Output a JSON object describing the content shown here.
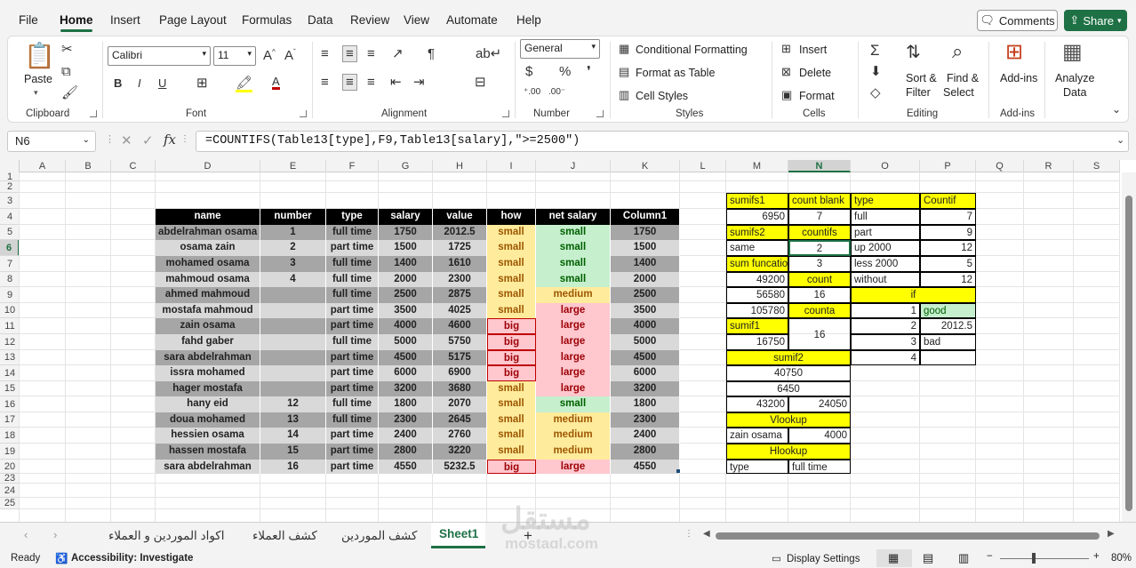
{
  "menu": [
    "File",
    "Home",
    "Insert",
    "Page Layout",
    "Formulas",
    "Data",
    "Review",
    "View",
    "Automate",
    "Help"
  ],
  "comments_label": "Comments",
  "share_label": "Share",
  "ribbon": {
    "clipboard": {
      "paste": "Paste",
      "label": "Clipboard"
    },
    "font": {
      "name": "Calibri",
      "size": "11",
      "label": "Font"
    },
    "alignment": {
      "label": "Alignment"
    },
    "number": {
      "format": "General",
      "label": "Number"
    },
    "styles": {
      "cond": "Conditional Formatting",
      "table": "Format as Table",
      "cell": "Cell Styles",
      "label": "Styles"
    },
    "cells": {
      "insert": "Insert",
      "delete": "Delete",
      "format": "Format",
      "label": "Cells"
    },
    "editing": {
      "sort": "Sort &",
      "filter": "Filter",
      "find": "Find &",
      "select": "Select",
      "label": "Editing"
    },
    "addins": {
      "btn": "Add-ins",
      "label": "Add-ins"
    },
    "analyze": {
      "l1": "Analyze",
      "l2": "Data"
    }
  },
  "namebox": "N6",
  "formula": "=COUNTIFS(Table13[type],F9,Table13[salary],\">=2500\")",
  "columns": [
    "A",
    "B",
    "C",
    "D",
    "E",
    "F",
    "G",
    "H",
    "I",
    "J",
    "K",
    "L",
    "M",
    "N",
    "O",
    "P",
    "Q",
    "R",
    "S"
  ],
  "rows": [
    "1",
    "2",
    "3",
    "4",
    "5",
    "6",
    "7",
    "8",
    "9",
    "10",
    "11",
    "12",
    "13",
    "14",
    "15",
    "16",
    "17",
    "18",
    "19",
    "20",
    "23",
    "24",
    "25"
  ],
  "table": {
    "headers": [
      "name",
      "number",
      "type",
      "salary",
      "value",
      "how",
      "net salary",
      "Column1"
    ],
    "rows": [
      [
        "abdelrahman osama",
        "1",
        "full time",
        "1750",
        "2012.5",
        "small",
        "small",
        "1750"
      ],
      [
        "osama zain",
        "2",
        "part time",
        "1500",
        "1725",
        "small",
        "small",
        "1500"
      ],
      [
        "mohamed osama",
        "3",
        "full time",
        "1400",
        "1610",
        "small",
        "small",
        "1400"
      ],
      [
        "mahmoud osama",
        "4",
        "full time",
        "2000",
        "2300",
        "small",
        "small",
        "2000"
      ],
      [
        "ahmed mahmoud",
        "",
        "full time",
        "2500",
        "2875",
        "small",
        "medium",
        "2500"
      ],
      [
        "mostafa mahmoud",
        "",
        "part time",
        "3500",
        "4025",
        "small",
        "large",
        "3500"
      ],
      [
        "zain osama",
        "",
        "part time",
        "4000",
        "4600",
        "big",
        "large",
        "4000"
      ],
      [
        "fahd gaber",
        "",
        "full time",
        "5000",
        "5750",
        "big",
        "large",
        "5000"
      ],
      [
        "sara abdelrahman",
        "",
        "part time",
        "4500",
        "5175",
        "big",
        "large",
        "4500"
      ],
      [
        "issra mohamed",
        "",
        "part time",
        "6000",
        "6900",
        "big",
        "large",
        "6000"
      ],
      [
        "hager mostafa",
        "",
        "part time",
        "3200",
        "3680",
        "small",
        "large",
        "3200"
      ],
      [
        "hany eid",
        "12",
        "full time",
        "1800",
        "2070",
        "small",
        "small",
        "1800"
      ],
      [
        "doua mohamed",
        "13",
        "full time",
        "2300",
        "2645",
        "small",
        "medium",
        "2300"
      ],
      [
        "hessien osama",
        "14",
        "part time",
        "2400",
        "2760",
        "small",
        "medium",
        "2400"
      ],
      [
        "hassen mostafa",
        "15",
        "part time",
        "2800",
        "3220",
        "small",
        "medium",
        "2800"
      ],
      [
        "sara abdelrahman",
        "16",
        "part time",
        "4550",
        "5232.5",
        "big",
        "large",
        "4550"
      ]
    ]
  },
  "side": {
    "m3": "sumifs1",
    "n3": "count blank",
    "o3": "type",
    "p3": "Countif",
    "m4": "6950",
    "n4": "7",
    "o4": "full",
    "p4": "7",
    "m5": "sumifs2",
    "n5": "countifs",
    "o5": "part",
    "p5": "9",
    "m6": "same",
    "n6": "2",
    "o6": "up 2000",
    "p6": "12",
    "m7": "sum funcation",
    "n7": "3",
    "o7": "less 2000",
    "p7": "5",
    "m8": "49200",
    "n8": "count",
    "o8": "without",
    "p8": "12",
    "m9": "56580",
    "n9": "16",
    "o9": "if",
    "m10": "105780",
    "n10": "counta",
    "o10": "1",
    "p10": "good",
    "m11": "sumif1",
    "n11": "16",
    "o11": "2",
    "p11": "2012.5",
    "m12": "16750",
    "o12": "3",
    "p12": "bad",
    "o13": "4",
    "m13": "sumif2",
    "m14": "40750",
    "m15": "6450",
    "m16": "43200",
    "n16": "24050",
    "m17": "Vlookup",
    "m18": "zain osama",
    "n18": "4000",
    "m19": "Hlookup",
    "m20": "type",
    "n20": "full time"
  },
  "sheet_tabs": [
    "اكواد الموردين و العملاء",
    "كشف العملاء",
    "كشف الموردين",
    "Sheet1"
  ],
  "status": {
    "ready": "Ready",
    "access": "Accessibility: Investigate",
    "display": "Display Settings",
    "zoom": "80%"
  },
  "watermark": {
    "ar": "مستقل",
    "en": "mostaql.com"
  },
  "colors": {
    "accent": "#1e7145",
    "yellow": "#ffff00",
    "dark_row": "#a6a6a6",
    "light_row": "#d9d9d9",
    "small_bg": "#ffeb9c",
    "small_fg": "#9c5700",
    "green_bg": "#c6efce",
    "green_fg": "#006100",
    "red_bg": "#ffc7ce",
    "red_fg": "#9c0006"
  }
}
